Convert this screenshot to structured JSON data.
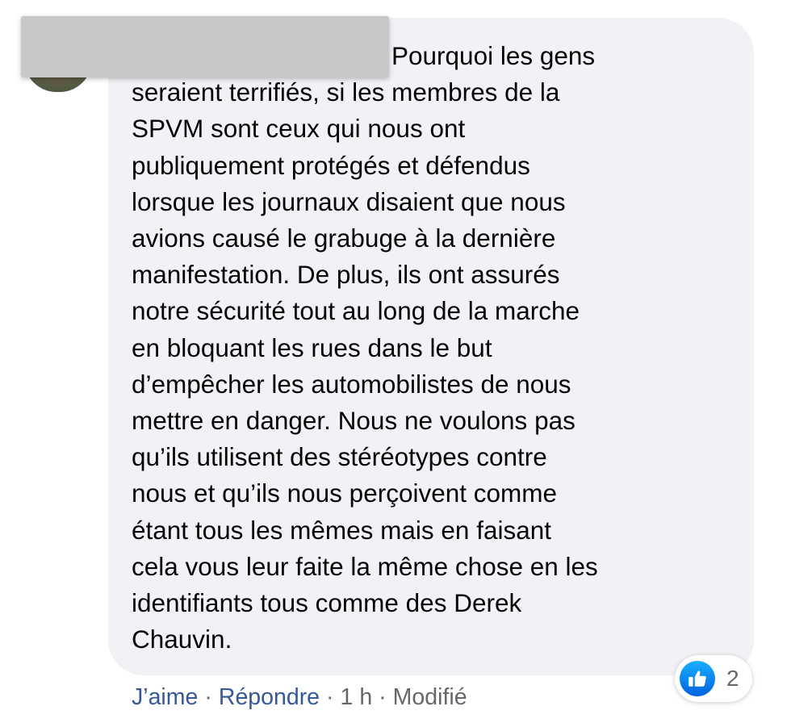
{
  "comment": {
    "text": "Pourquoi les gens\nseraient terrifiés, si les membres de la\nSPVM sont ceux qui nous ont\npubliquement protégés et défendus\nlorsque les journaux disaient que nous\navions causé le grabuge à la dernière\nmanifestation. De plus, ils ont assurés\nnotre sécurité tout au long de la marche\nen bloquant les rues dans le but\nd’empêcher les automobilistes de nous\nmettre en danger. Nous ne voulons pas\nqu’ils utilisent des stéréotypes contre\nnous et qu’ils nous perçoivent comme\nétant tous les mêmes mais en faisant\ncela vous leur faite la même chose en les\nidentifiants tous comme des Derek\nChauvin."
  },
  "reactions": {
    "icon": "thumbs-up-icon",
    "count": "2",
    "color": "#1877f2"
  },
  "actions": {
    "like_label": "J’aime",
    "reply_label": "Répondre",
    "separator": "·",
    "time": "1 h",
    "edited_label": "Modifié"
  }
}
